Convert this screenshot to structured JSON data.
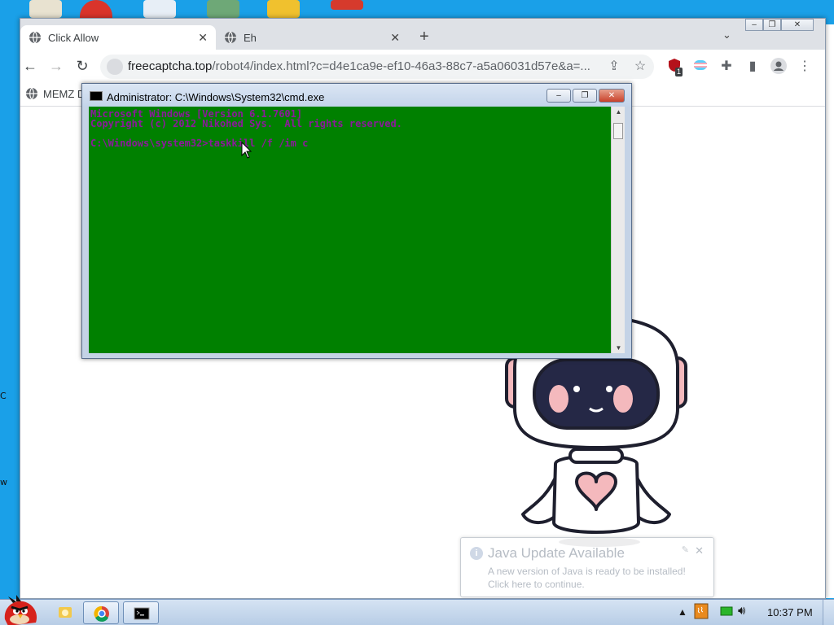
{
  "colors": {
    "desktop": "#1aa0e8",
    "console_bg": "#008000",
    "console_text": "#8b1a9a",
    "robot_pink": "#f4b9bd",
    "robot_face": "#252846"
  },
  "browser": {
    "tabs": [
      {
        "label": "Click Allow",
        "active": true
      },
      {
        "label": "Eh",
        "active": false
      }
    ],
    "url_host": "freecaptcha.top",
    "url_rest": "/robot4/index.html?c=d4e1ca9e-ef10-46a3-88c7-a5a06031d57e&a=...",
    "extension_badge": "1",
    "bookmark_label": "MEMZ D"
  },
  "cmd": {
    "title": "Administrator: C:\\Windows\\System32\\cmd.exe",
    "lines": [
      "Microsoft Windows [Version 6.1.7601]",
      "Copyright (c) 2012 Nikohed Sys.  All rights reserved.",
      "",
      "C:\\Windows\\system32>taskkill /f /im c"
    ]
  },
  "desktop_side_labels": [
    "C",
    "w"
  ],
  "notification": {
    "title": "Java Update Available",
    "line1": "A new version of Java is ready to be installed!",
    "line2": "Click here to continue."
  },
  "taskbar": {
    "clock": "10:37 PM"
  }
}
